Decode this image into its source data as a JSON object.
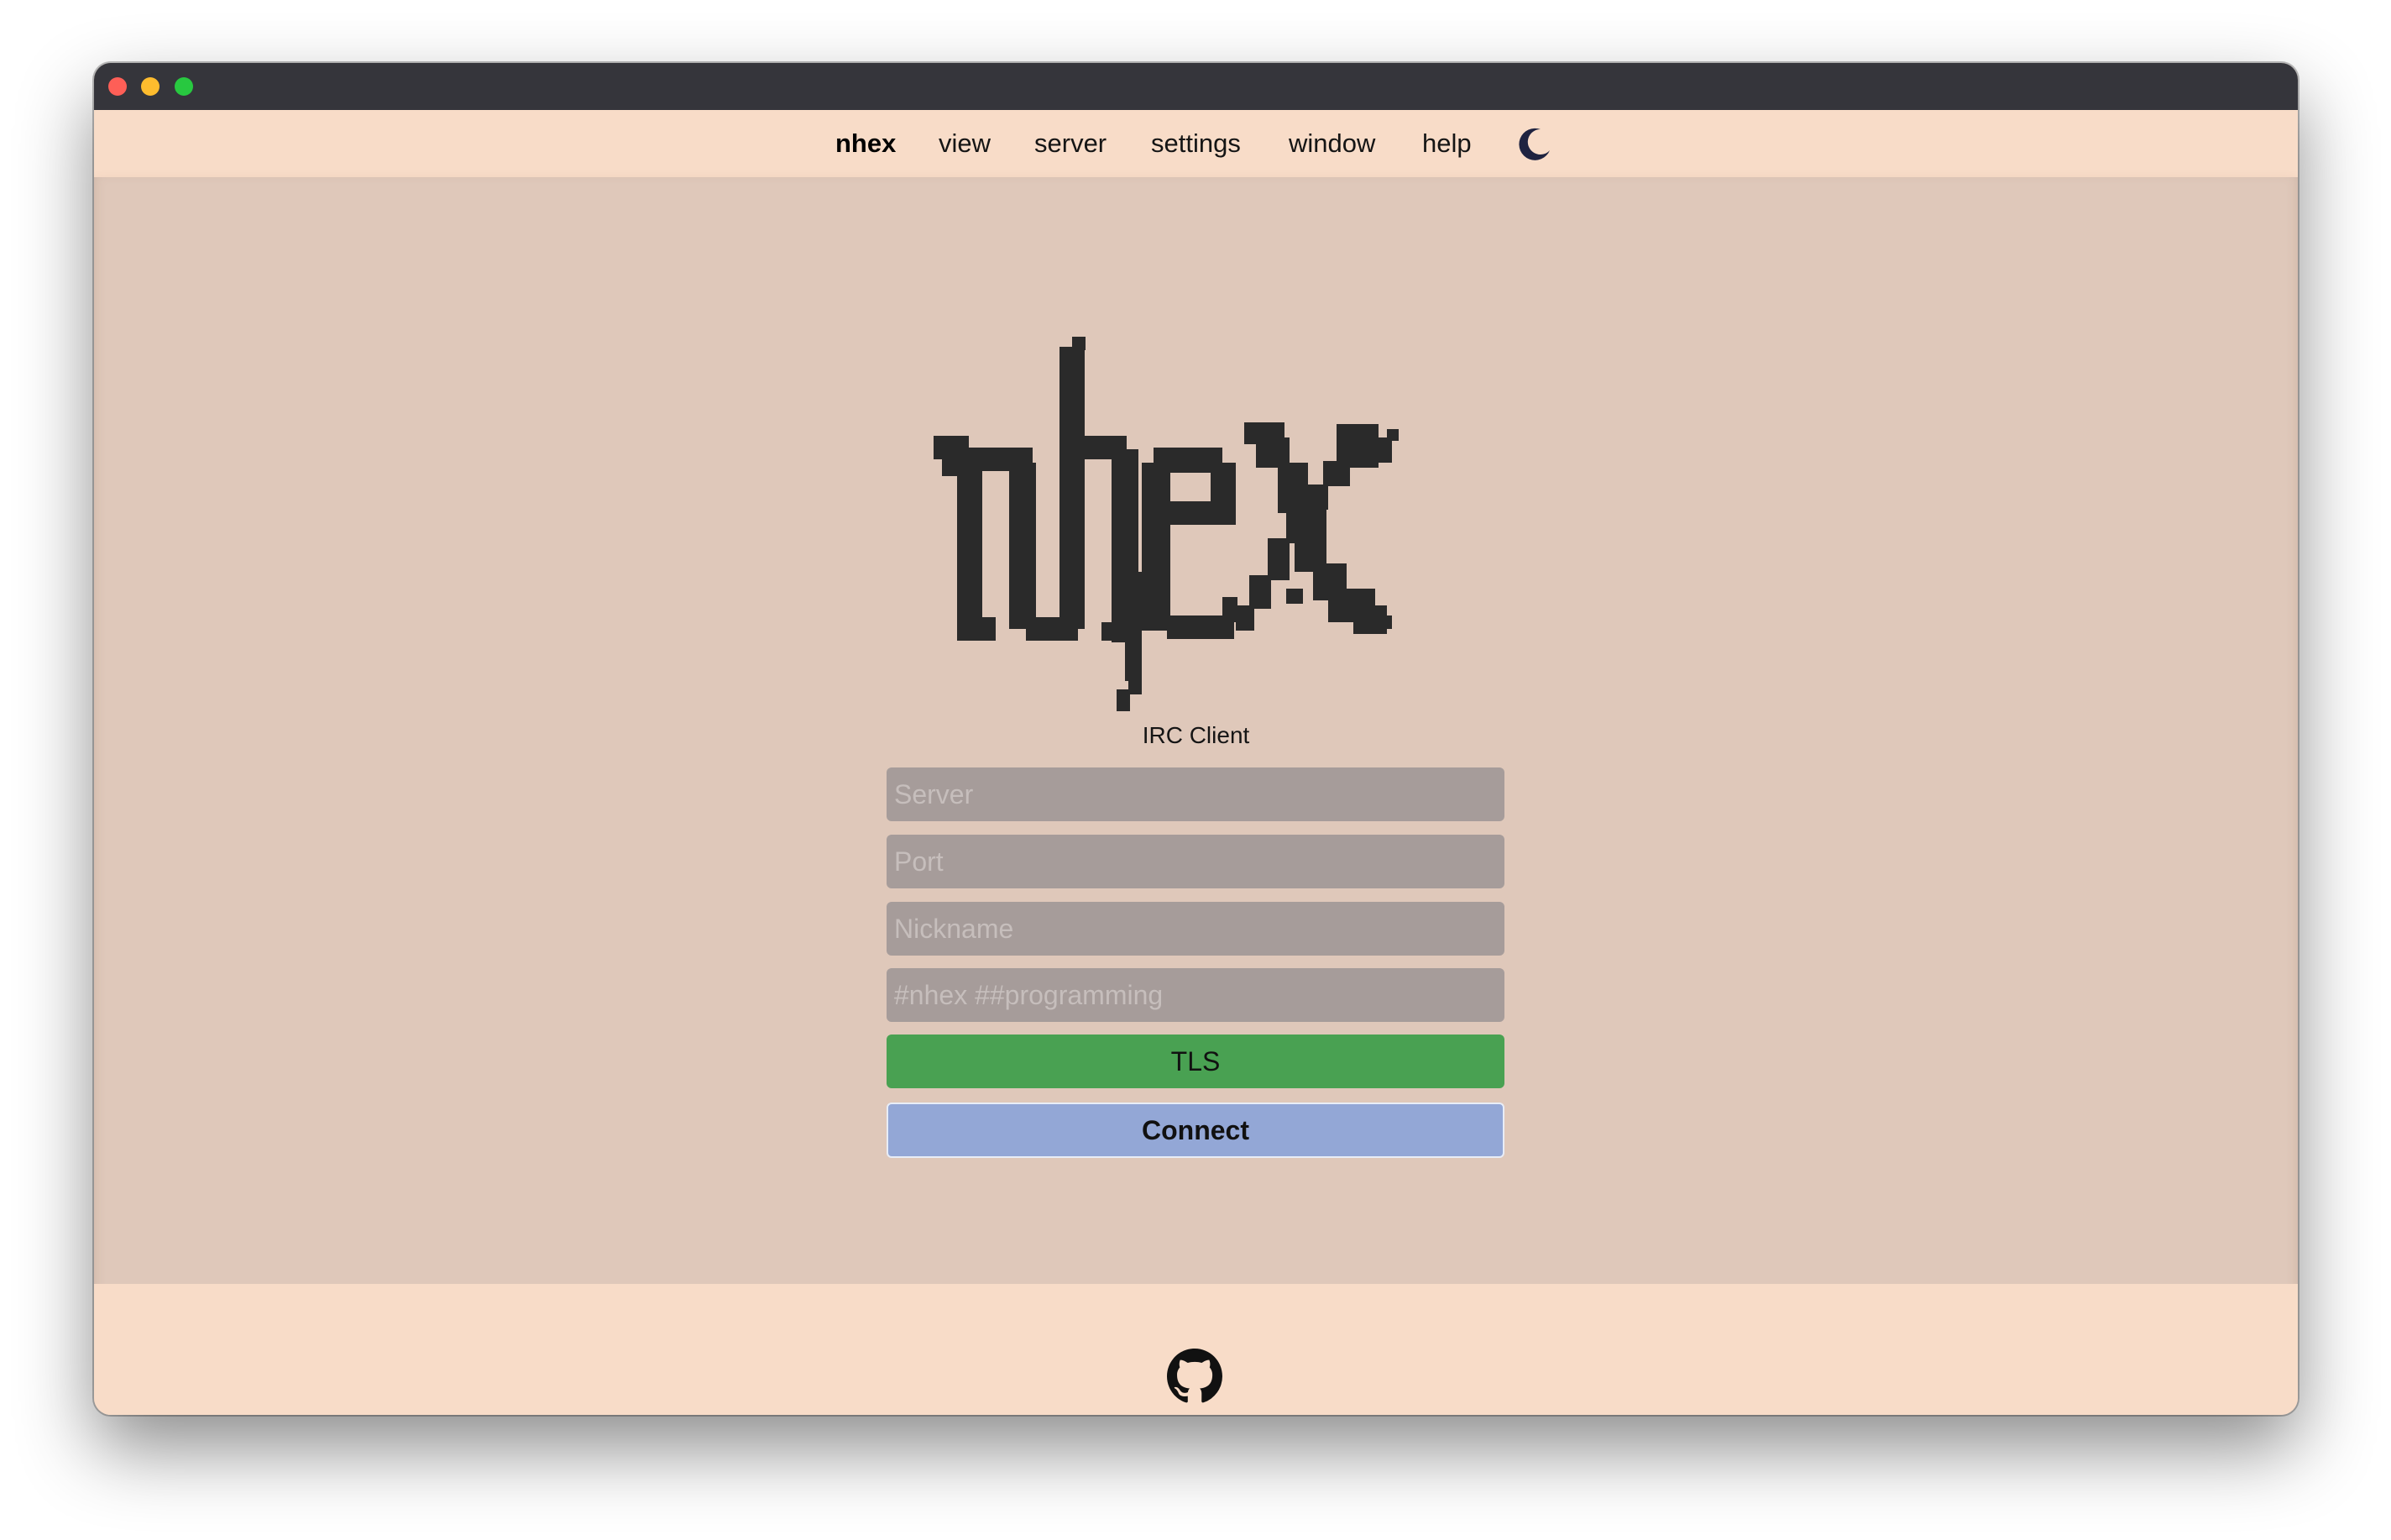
{
  "menubar": {
    "items": [
      {
        "label": "nhex"
      },
      {
        "label": "view"
      },
      {
        "label": "server"
      },
      {
        "label": "settings"
      },
      {
        "label": "window"
      },
      {
        "label": "help"
      }
    ],
    "theme_toggle_icon": "moon-icon"
  },
  "logo": {
    "text": "nhex",
    "subtitle": "IRC Client",
    "color": "#2a2a2a"
  },
  "form": {
    "server_placeholder": "Server",
    "port_placeholder": "Port",
    "nickname_placeholder": "Nickname",
    "channels_placeholder": "#nhex ##programming",
    "tls_label": "TLS",
    "connect_label": "Connect"
  },
  "footer": {
    "icon": "github-icon"
  },
  "colors": {
    "titlebar": "#35353b",
    "menubar": "#f8dcc8",
    "main_bg": "#dfc8ba",
    "field_bg": "#a69c9a",
    "tls_bg": "#49a152",
    "connect_bg": "#93a7d6"
  }
}
